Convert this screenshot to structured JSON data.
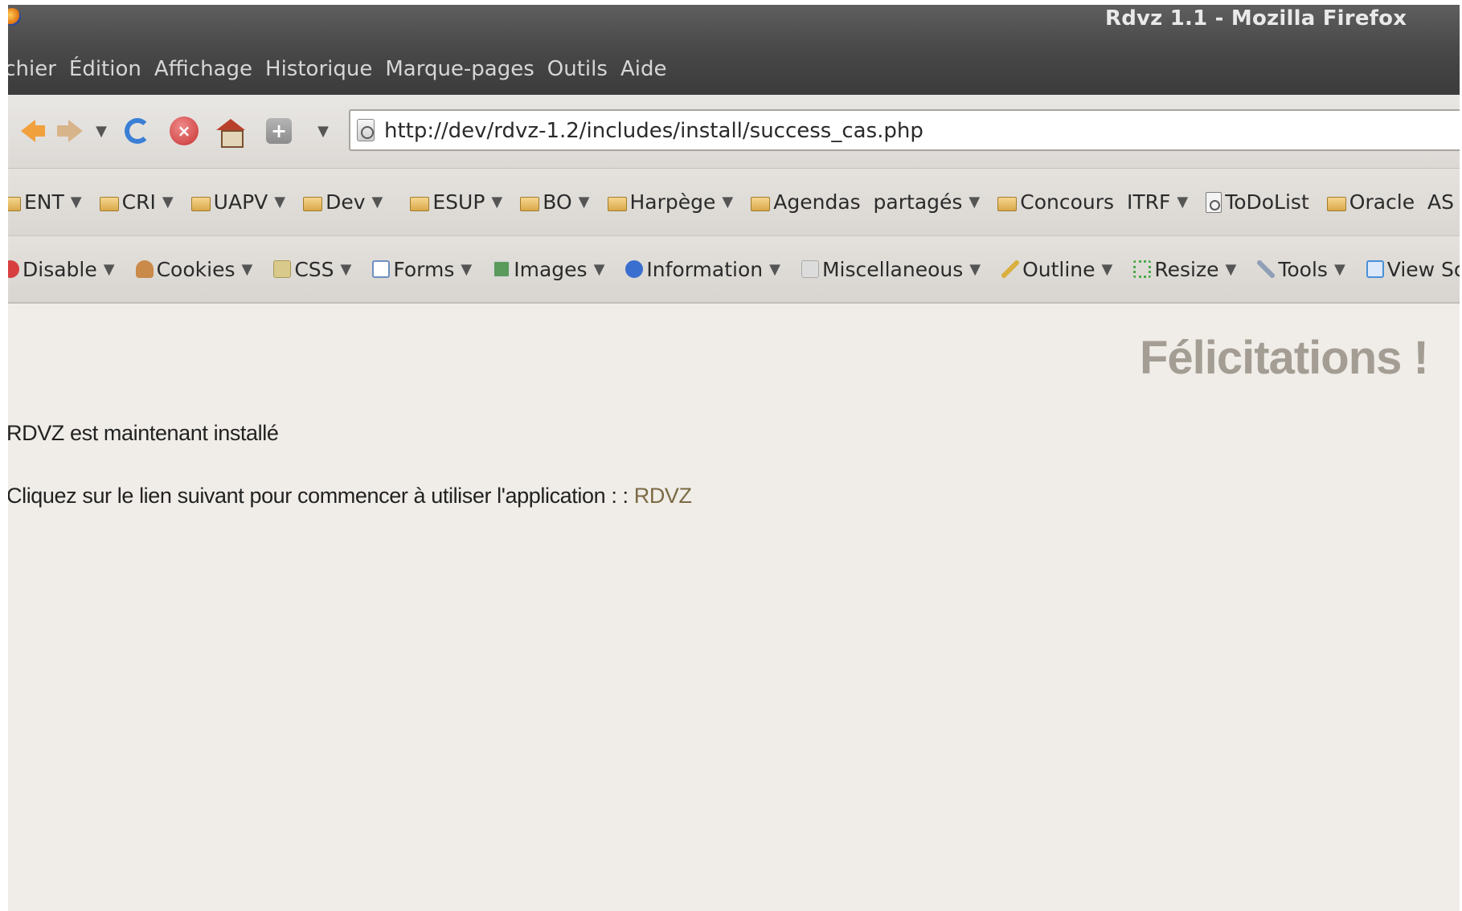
{
  "window": {
    "title": "Rdvz 1.1 - Mozilla Firefox"
  },
  "menubar": {
    "items": [
      {
        "label": "ichier"
      },
      {
        "label": "Édition"
      },
      {
        "label": "Affichage"
      },
      {
        "label": "Historique"
      },
      {
        "label": "Marque-pages"
      },
      {
        "label": "Outils"
      },
      {
        "label": "Aide"
      }
    ]
  },
  "navbar": {
    "url": "http://dev/rdvz-1.2/includes/install/success_cas.php",
    "caret": "▼"
  },
  "bookmarks": {
    "items": [
      {
        "label": "ENT",
        "icon": "folder-icon"
      },
      {
        "label": "CRI",
        "icon": "folder-icon"
      },
      {
        "label": "UAPV",
        "icon": "folder-icon"
      },
      {
        "label": "Dev",
        "icon": "folder-icon"
      },
      {
        "label": "ESUP",
        "icon": "folder-icon"
      },
      {
        "label": "BO",
        "icon": "folder-icon"
      },
      {
        "label": "Harpège",
        "icon": "folder-icon"
      },
      {
        "label": "Agendas  partagés",
        "icon": "folder-icon"
      },
      {
        "label": "Concours  ITRF",
        "icon": "folder-icon"
      },
      {
        "label": "ToDoList",
        "icon": "page-icon"
      },
      {
        "label": "Oracle  AS",
        "icon": "folder-icon"
      }
    ]
  },
  "devtoolbar": {
    "items": [
      {
        "label": "Disable",
        "icon": "disable-icon",
        "color": "#d84040"
      },
      {
        "label": "Cookies",
        "icon": "cookies-icon",
        "color": "#c98a4a"
      },
      {
        "label": "CSS",
        "icon": "css-icon",
        "color": "#d9c98a"
      },
      {
        "label": "Forms",
        "icon": "forms-icon",
        "color": "#6f8fc0"
      },
      {
        "label": "Images",
        "icon": "images-icon",
        "color": "#5a9a5a"
      },
      {
        "label": "Information",
        "icon": "information-icon",
        "color": "#3a6fd0"
      },
      {
        "label": "Miscellaneous",
        "icon": "miscellaneous-icon",
        "color": "#c9c9c9"
      },
      {
        "label": "Outline",
        "icon": "outline-icon",
        "color": "#d9b040"
      },
      {
        "label": "Resize",
        "icon": "resize-icon",
        "color": "#4aaa4a"
      },
      {
        "label": "Tools",
        "icon": "tools-icon",
        "color": "#8f9fb8"
      },
      {
        "label": "View Source",
        "icon": "view-source-icon",
        "color": "#4a8fd8"
      }
    ]
  },
  "page": {
    "heading": "Félicitations !",
    "line1": "RDVZ est maintenant installé",
    "line2_text": "Cliquez sur le lien suivant pour commencer à utiliser l'application : : ",
    "link_label": "RDVZ"
  }
}
